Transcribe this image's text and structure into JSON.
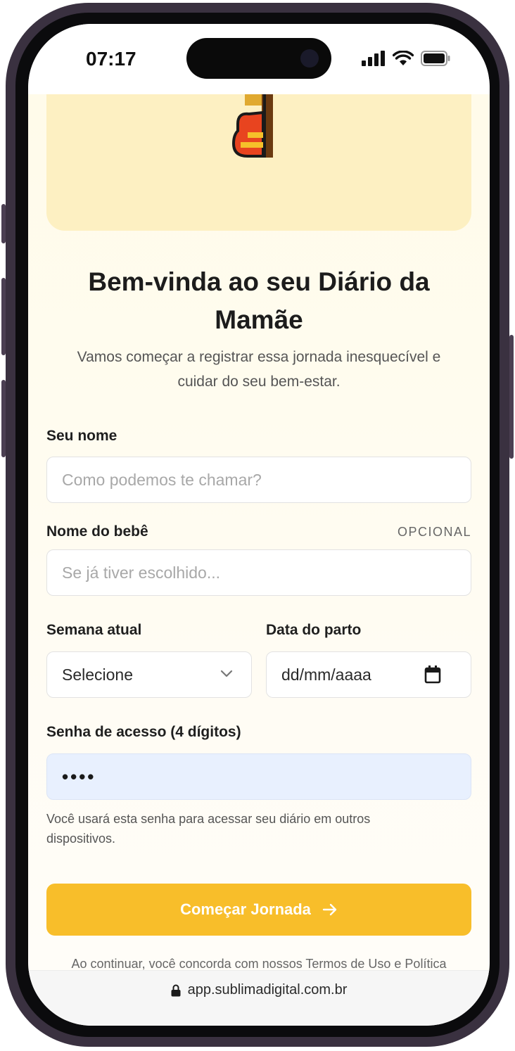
{
  "status_bar": {
    "time": "07:17"
  },
  "hero": {
    "image": "pregnant-woman-emoji"
  },
  "welcome": {
    "title": "Bem-vinda ao seu Diário da Mamãe",
    "subtitle": "Vamos começar a registrar essa jornada inesquecível e cuidar do seu bem-estar."
  },
  "form": {
    "name": {
      "label": "Seu nome",
      "placeholder": "Como podemos te chamar?"
    },
    "baby_name": {
      "label": "Nome do bebê",
      "optional": "OPCIONAL",
      "placeholder": "Se já tiver escolhido..."
    },
    "week": {
      "label": "Semana atual",
      "value": "Selecione"
    },
    "due_date": {
      "label": "Data do parto",
      "placeholder": "dd/mm/aaaa"
    },
    "password": {
      "label": "Senha de acesso (4 dígitos)",
      "value": "••••",
      "help": "Você usará esta senha para acessar seu diário em outros dispositivos."
    },
    "submit_label": "Começar Jornada"
  },
  "footer": {
    "terms_text": "Ao continuar, você concorda com nossos Termos de Uso e Política"
  },
  "browser": {
    "url": "app.sublimadigital.com.br"
  },
  "colors": {
    "accent": "#f8be2a",
    "hero_bg": "#fdf0c2",
    "password_bg": "#e8f0fe"
  }
}
